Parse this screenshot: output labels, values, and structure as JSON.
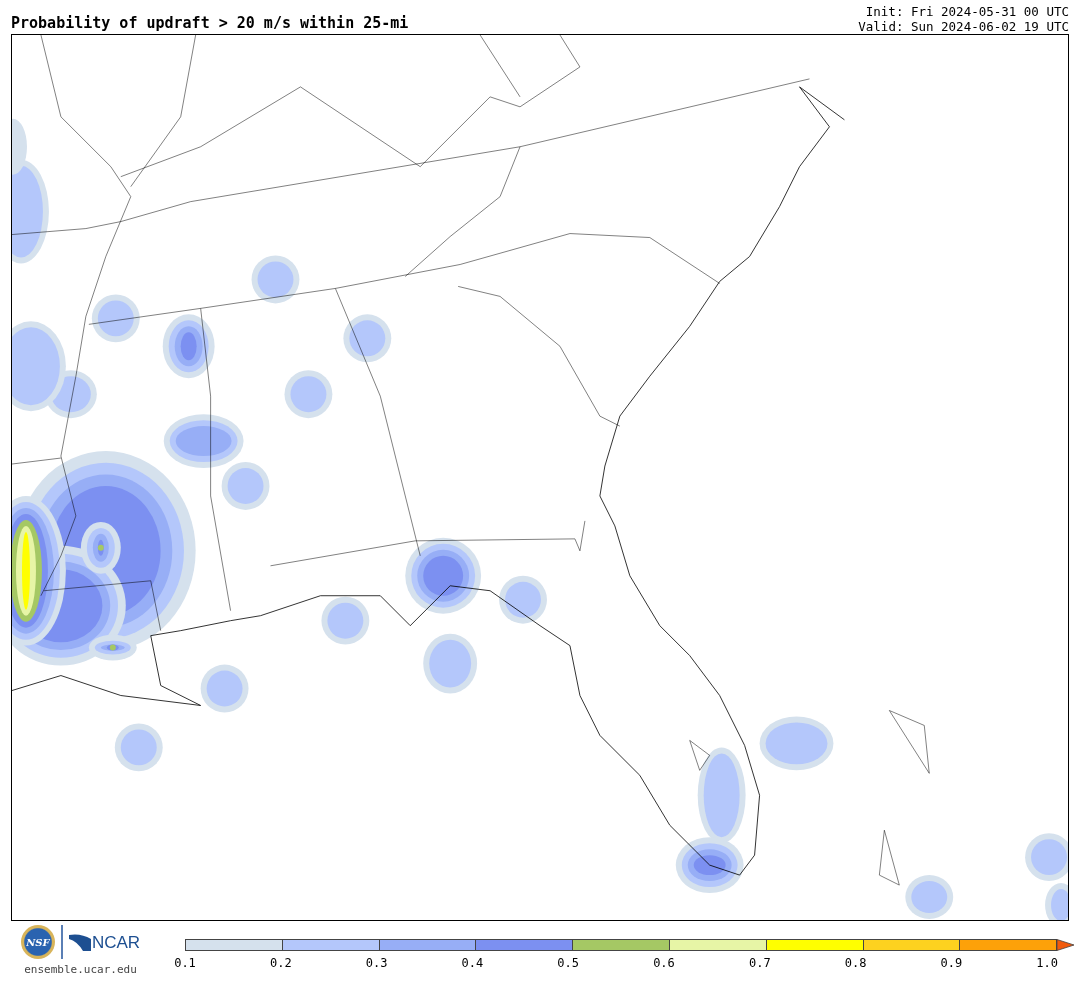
{
  "title": "Probability of updraft > 20 m/s within 25-mi",
  "init": "Init: Fri 2024-05-31 00 UTC",
  "valid": "Valid: Sun 2024-06-02 19 UTC",
  "logos": {
    "nsf": "NSF",
    "ncar": "NCAR",
    "site": "ensemble.ucar.edu"
  },
  "colorbar": {
    "bins": [
      {
        "color": "#d5e1ed"
      },
      {
        "color": "#b4c7fb"
      },
      {
        "color": "#97aef6"
      },
      {
        "color": "#7c90f1"
      },
      {
        "color": "#a5c864"
      },
      {
        "color": "#e7f5a6"
      },
      {
        "color": "#ffff00"
      },
      {
        "color": "#fdd21f"
      },
      {
        "color": "#fda109"
      }
    ],
    "extend": {
      "color": "#f15a0c"
    },
    "ticks": [
      "0.1",
      "0.2",
      "0.3",
      "0.4",
      "0.5",
      "0.6",
      "0.7",
      "0.8",
      "0.9",
      "1.0"
    ]
  }
}
